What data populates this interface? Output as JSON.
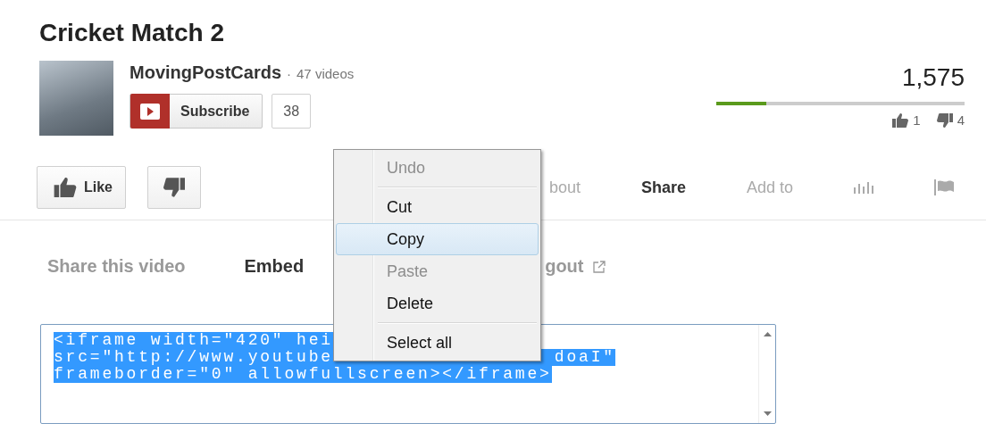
{
  "video": {
    "title": "Cricket Match 2"
  },
  "channel": {
    "name": "MovingPostCards",
    "separator": "·",
    "video_count": "47 videos",
    "subscribe_label": "Subscribe",
    "subscriber_count": "38"
  },
  "stats": {
    "views": "1,575",
    "level": 0.2,
    "likes": "1",
    "dislikes": "4"
  },
  "actions": {
    "like_label": "Like"
  },
  "tabs": [
    {
      "kind": "text",
      "label": "bout",
      "selected": false
    },
    {
      "kind": "text",
      "label": "Share",
      "selected": true
    },
    {
      "kind": "text",
      "label": "Add to",
      "selected": false
    },
    {
      "kind": "stats",
      "selected": false
    },
    {
      "kind": "flag",
      "selected": false
    }
  ],
  "share_tabs": [
    {
      "label": "Share this video",
      "selected": false,
      "external": false
    },
    {
      "label": "Embed",
      "selected": true,
      "external": false
    },
    {
      "label": "gout",
      "selected": false,
      "external": true
    }
  ],
  "embed_code": {
    "lines": [
      {
        "parts": [
          "<iframe width=\"420\" hei"
        ]
      },
      {
        "parts": [
          "src=\"http://www.youtube",
          "doaI\""
        ]
      },
      {
        "parts": [
          "frameborder=\"0\" allowfullscreen></iframe>"
        ]
      }
    ]
  },
  "context_menu": [
    {
      "kind": "item",
      "label": "Undo",
      "disabled": true,
      "selected": false
    },
    {
      "kind": "separator"
    },
    {
      "kind": "item",
      "label": "Cut",
      "disabled": false,
      "selected": false
    },
    {
      "kind": "item",
      "label": "Copy",
      "disabled": false,
      "selected": true
    },
    {
      "kind": "item",
      "label": "Paste",
      "disabled": true,
      "selected": false
    },
    {
      "kind": "item",
      "label": "Delete",
      "disabled": false,
      "selected": false
    },
    {
      "kind": "separator"
    },
    {
      "kind": "item",
      "label": "Select all",
      "disabled": false,
      "selected": false
    }
  ]
}
